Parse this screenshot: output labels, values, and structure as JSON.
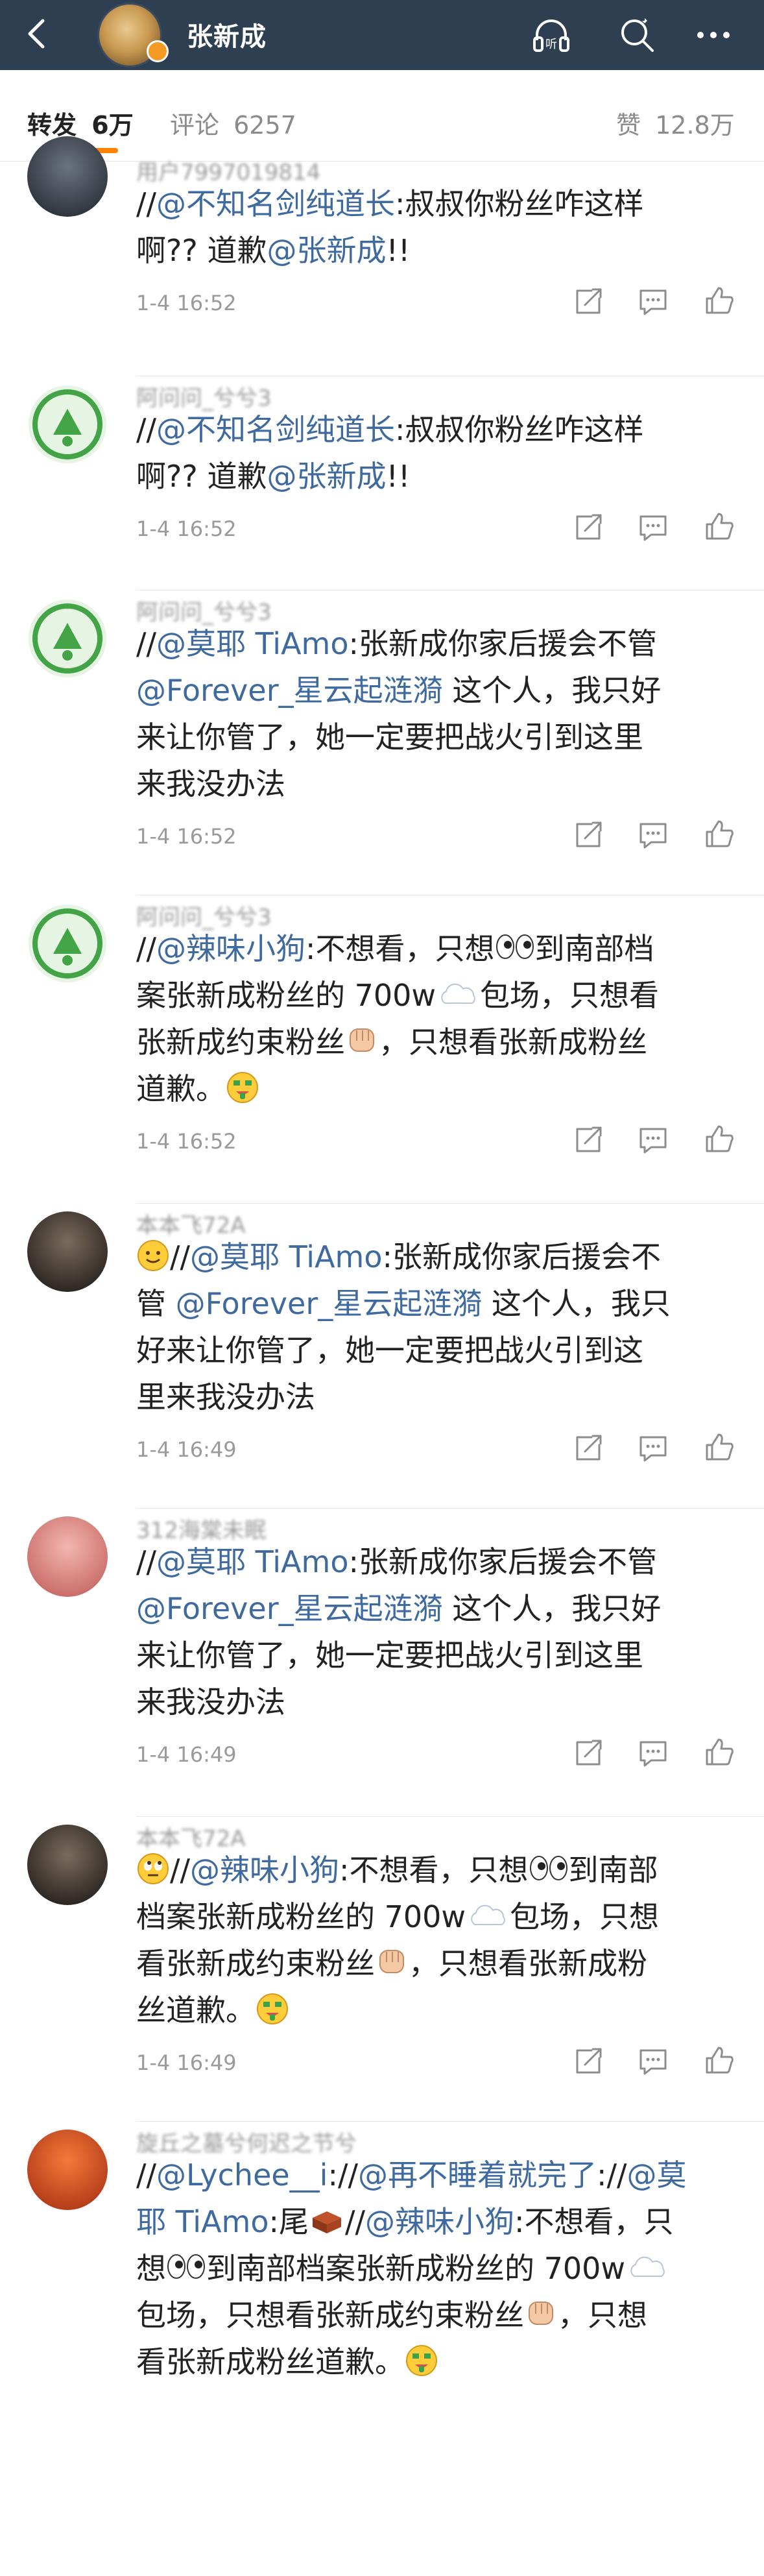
{
  "header": {
    "title": "张新成",
    "icons": [
      "back-icon",
      "listen-icon",
      "search-icon",
      "more-icon"
    ],
    "colors": {
      "bar": "#2f3f52",
      "accent": "#ff8200",
      "link": "#3e6a9f"
    }
  },
  "tabs": [
    {
      "label": "转发",
      "count": "6万",
      "active": true
    },
    {
      "label": "评论",
      "count": "6257",
      "active": false
    }
  ],
  "likes": {
    "label": "赞",
    "count": "12.8万"
  },
  "comments": [
    {
      "user": "用户7997019814",
      "time": "1-4 16:52",
      "avatar": "photo-avatar",
      "lines": [
        [
          {
            "t": "//",
            "at": false
          },
          {
            "t": "@不知名剑纯道长",
            "at": true
          },
          {
            "t": ":叔叔你粉丝咋这样",
            "at": false
          }
        ],
        [
          {
            "t": "啊?? 道歉",
            "at": false
          },
          {
            "t": "@张新成",
            "at": true
          },
          {
            "t": "!!",
            "at": false
          }
        ]
      ]
    },
    {
      "user": "阿问问_兮兮3",
      "time": "1-4 16:52",
      "avatar": "green-logo-avatar",
      "lines": [
        [
          {
            "t": "//",
            "at": false
          },
          {
            "t": "@不知名剑纯道长",
            "at": true
          },
          {
            "t": ":叔叔你粉丝咋这样",
            "at": false
          }
        ],
        [
          {
            "t": "啊?? 道歉",
            "at": false
          },
          {
            "t": "@张新成",
            "at": true
          },
          {
            "t": "!!",
            "at": false
          }
        ]
      ]
    },
    {
      "user": "阿问问_兮兮3",
      "time": "1-4 16:52",
      "avatar": "green-logo-avatar",
      "lines": [
        [
          {
            "t": "//",
            "at": false
          },
          {
            "t": "@莫耶 TiAmo",
            "at": true
          },
          {
            "t": ":张新成你家后援会不管",
            "at": false
          }
        ],
        [
          {
            "t": "@Forever_星云起涟漪",
            "at": true
          },
          {
            "t": " 这个人，我只好",
            "at": false
          }
        ],
        [
          {
            "t": "来让你管了，她一定要把战火引到这里",
            "at": false
          }
        ],
        [
          {
            "t": "来我没办法",
            "at": false
          }
        ]
      ]
    },
    {
      "user": "阿问问_兮兮3",
      "time": "1-4 16:52",
      "avatar": "green-logo-avatar",
      "lines": [
        [
          {
            "t": "//",
            "at": false
          },
          {
            "t": "@辣味小狗",
            "at": true
          },
          {
            "t": ":不想看，只想",
            "at": false
          },
          {
            "e": "eyes"
          },
          {
            "t": "到南部档",
            "at": false
          }
        ],
        [
          {
            "t": "案张新成粉丝的 700w",
            "at": false
          },
          {
            "e": "cloud"
          },
          {
            "t": "包场，只想看",
            "at": false
          }
        ],
        [
          {
            "t": "张新成约束粉丝",
            "at": false
          },
          {
            "e": "fist"
          },
          {
            "t": "，只想看张新成粉丝",
            "at": false
          }
        ],
        [
          {
            "t": "道歉。",
            "at": false
          },
          {
            "e": "money"
          }
        ]
      ]
    },
    {
      "user": "本本飞72A",
      "time": "1-4 16:49",
      "avatar": "photo-avatar-dark",
      "lines": [
        [
          {
            "e": "smile"
          },
          {
            "t": "//",
            "at": false
          },
          {
            "t": "@莫耶 TiAmo",
            "at": true
          },
          {
            "t": ":张新成你家后援会不",
            "at": false
          }
        ],
        [
          {
            "t": "管 ",
            "at": false
          },
          {
            "t": "@Forever_星云起涟漪",
            "at": true
          },
          {
            "t": " 这个人，我只",
            "at": false
          }
        ],
        [
          {
            "t": "好来让你管了，她一定要把战火引到这",
            "at": false
          }
        ],
        [
          {
            "t": "里来我没办法",
            "at": false
          }
        ]
      ]
    },
    {
      "user": "312海棠未眠",
      "time": "1-4 16:49",
      "avatar": "photo-avatar-pink",
      "lines": [
        [
          {
            "t": "//",
            "at": false
          },
          {
            "t": "@莫耶 TiAmo",
            "at": true
          },
          {
            "t": ":张新成你家后援会不管",
            "at": false
          }
        ],
        [
          {
            "t": "@Forever_星云起涟漪",
            "at": true
          },
          {
            "t": " 这个人，我只好",
            "at": false
          }
        ],
        [
          {
            "t": "来让你管了，她一定要把战火引到这里",
            "at": false
          }
        ],
        [
          {
            "t": "来我没办法",
            "at": false
          }
        ]
      ]
    },
    {
      "user": "本本飞72A",
      "time": "1-4 16:49",
      "avatar": "photo-avatar-dark",
      "lines": [
        [
          {
            "e": "rolleyes"
          },
          {
            "t": "//",
            "at": false
          },
          {
            "t": "@辣味小狗",
            "at": true
          },
          {
            "t": ":不想看，只想",
            "at": false
          },
          {
            "e": "eyes"
          },
          {
            "t": "到南部",
            "at": false
          }
        ],
        [
          {
            "t": "档案张新成粉丝的 700w",
            "at": false
          },
          {
            "e": "cloud"
          },
          {
            "t": "包场，只想",
            "at": false
          }
        ],
        [
          {
            "t": "看张新成约束粉丝",
            "at": false
          },
          {
            "e": "fist"
          },
          {
            "t": "，只想看张新成粉",
            "at": false
          }
        ],
        [
          {
            "t": "丝道歉。",
            "at": false
          },
          {
            "e": "money"
          }
        ]
      ]
    },
    {
      "user": "旋丘之墓兮何迟之节兮",
      "time": "",
      "avatar": "photo-avatar-red",
      "lines": [
        [
          {
            "t": "//",
            "at": false
          },
          {
            "t": "@Lychee__i",
            "at": true
          },
          {
            "t": "://",
            "at": false
          },
          {
            "t": "@再不睡着就完了",
            "at": true
          },
          {
            "t": "://",
            "at": false
          },
          {
            "t": "@莫",
            "at": true
          }
        ],
        [
          {
            "t": "耶 TiAmo",
            "at": true
          },
          {
            "t": ":尾",
            "at": false
          },
          {
            "e": "brick"
          },
          {
            "t": "//",
            "at": false
          },
          {
            "t": "@辣味小狗",
            "at": true
          },
          {
            "t": ":不想看，只",
            "at": false
          }
        ],
        [
          {
            "t": "想",
            "at": false
          },
          {
            "e": "eyes"
          },
          {
            "t": "到南部档案张新成粉丝的 700w",
            "at": false
          },
          {
            "e": "cloud"
          }
        ],
        [
          {
            "t": "包场，只想看张新成约束粉丝",
            "at": false
          },
          {
            "e": "fist"
          },
          {
            "t": "，只想",
            "at": false
          }
        ],
        [
          {
            "t": "看张新成粉丝道歉。",
            "at": false
          },
          {
            "e": "money"
          }
        ]
      ]
    }
  ]
}
